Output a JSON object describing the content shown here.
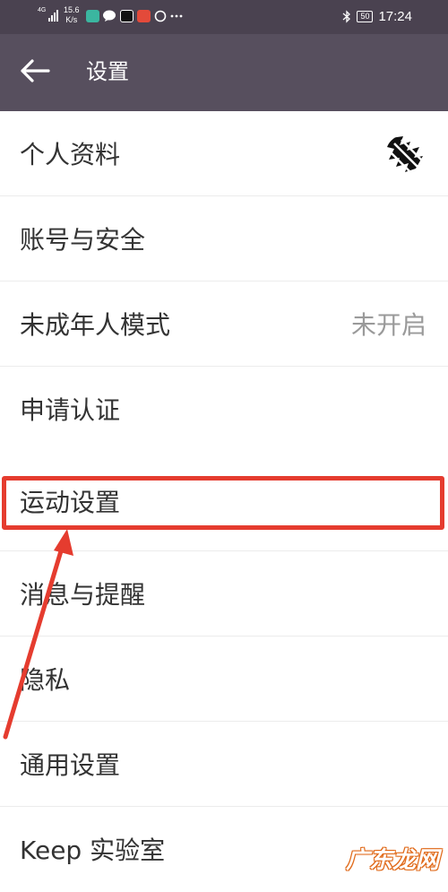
{
  "status_bar": {
    "network": "4G",
    "speed_value": "15.6",
    "speed_unit": "K/s",
    "battery": "50",
    "time": "17:24",
    "icons": [
      "signal-icon",
      "wechat-icon",
      "tiktok-icon",
      "app-icon",
      "loading-icon",
      "more-icon",
      "bluetooth-icon",
      "battery-icon"
    ]
  },
  "header": {
    "title": "设置",
    "back_icon": "arrow-left-icon"
  },
  "settings": {
    "items": [
      {
        "label": "个人资料",
        "value": ""
      },
      {
        "label": "账号与安全",
        "value": ""
      },
      {
        "label": "未成年人模式",
        "value": "未开启"
      },
      {
        "label": "申请认证",
        "value": ""
      },
      {
        "label": "运动设置",
        "value": ""
      },
      {
        "label": "消息与提醒",
        "value": ""
      },
      {
        "label": "隐私",
        "value": ""
      },
      {
        "label": "通用设置",
        "value": ""
      },
      {
        "label": "Keep 实验室",
        "value": ""
      }
    ]
  },
  "annotation": {
    "highlight_color": "#e53c2f"
  },
  "watermark": "广东龙网"
}
